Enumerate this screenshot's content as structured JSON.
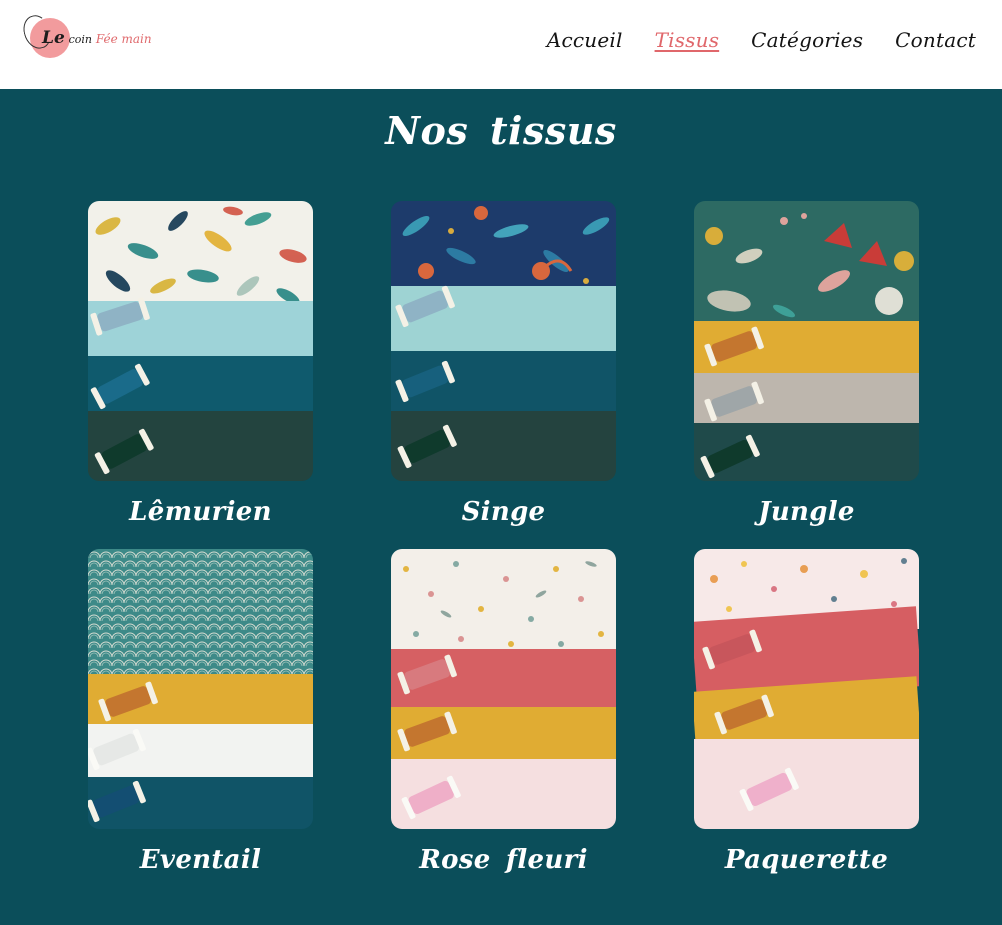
{
  "brand": {
    "logo_le": "Le",
    "logo_coin": "coin",
    "logo_fee": "Fée main",
    "colors": {
      "pink": "#e0676b",
      "teal": "#0b4e5a"
    }
  },
  "nav": {
    "items": [
      {
        "label": "Accueil",
        "active": false
      },
      {
        "label": "Tissus",
        "active": true
      },
      {
        "label": "Catégories",
        "active": false
      },
      {
        "label": "Contact",
        "active": false
      }
    ]
  },
  "main": {
    "title": "Nos tissus",
    "fabrics": [
      {
        "name": "Lêmurien"
      },
      {
        "name": "Singe"
      },
      {
        "name": "Jungle"
      },
      {
        "name": "Eventail"
      },
      {
        "name": "Rose fleuri"
      },
      {
        "name": "Paquerette"
      }
    ]
  }
}
